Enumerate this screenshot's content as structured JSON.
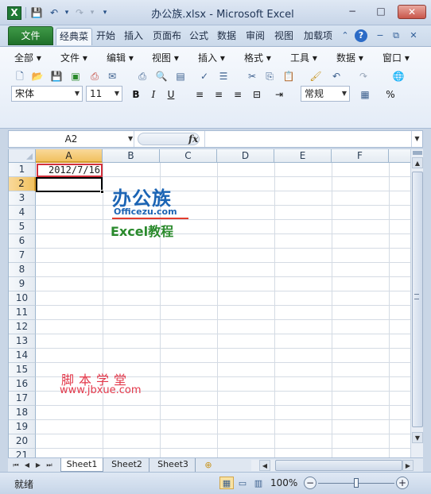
{
  "title_bar": {
    "app_icon": "X",
    "title": "办公族.xlsx  -  Microsoft Excel",
    "quick_access": {
      "save_icon": "💾",
      "undo_icon": "↶",
      "redo_icon": "↷",
      "customize_icon": "▾"
    },
    "minimize": "−",
    "maximize": "□",
    "close": "✕"
  },
  "tabs": {
    "file": "文件",
    "items": [
      "经典菜",
      "开始",
      "插入",
      "页面布",
      "公式",
      "数据",
      "审阅",
      "视图",
      "加载项"
    ]
  },
  "menus": [
    "全部 ▾",
    "文件 ▾",
    "编辑 ▾",
    "视图 ▾",
    "插入 ▾",
    "格式 ▾",
    "工具 ▾",
    "数据 ▾",
    "窗口 ▾"
  ],
  "toolbar": {
    "font_name": "宋体",
    "font_size": "11",
    "bold": "B",
    "italic": "I",
    "underline": "U",
    "number_format": "常规",
    "percent": "%"
  },
  "formula_bar": {
    "name_box": "A2",
    "fx": "fx",
    "value": ""
  },
  "columns": [
    "A",
    "B",
    "C",
    "D",
    "E",
    "F"
  ],
  "rows": [
    "1",
    "2",
    "3",
    "4",
    "5",
    "6",
    "7",
    "8",
    "9",
    "10",
    "11",
    "12",
    "13",
    "14",
    "15",
    "16",
    "17",
    "18",
    "19",
    "20",
    "21"
  ],
  "cells": {
    "A1": "2012/7/16"
  },
  "watermark": {
    "logo_main": "办公族",
    "logo_sub": "Officezu.com",
    "logo_tag": "Excel教程",
    "site_cn": "脚本学堂",
    "site_url": "www.jbxue.com"
  },
  "sheets": [
    "Sheet1",
    "Sheet2",
    "Sheet3"
  ],
  "status": {
    "ready": "就绪",
    "zoom": "100%",
    "zoom_level_percent": 100,
    "zoom_minus": "−",
    "zoom_plus": "+"
  },
  "colors": {
    "file_tab": "#1f6f2a",
    "selection_border": "#000000",
    "header_highlight": "#f1c15f",
    "watermark_red": "#e3384a",
    "logo_blue": "#1b64b4"
  }
}
